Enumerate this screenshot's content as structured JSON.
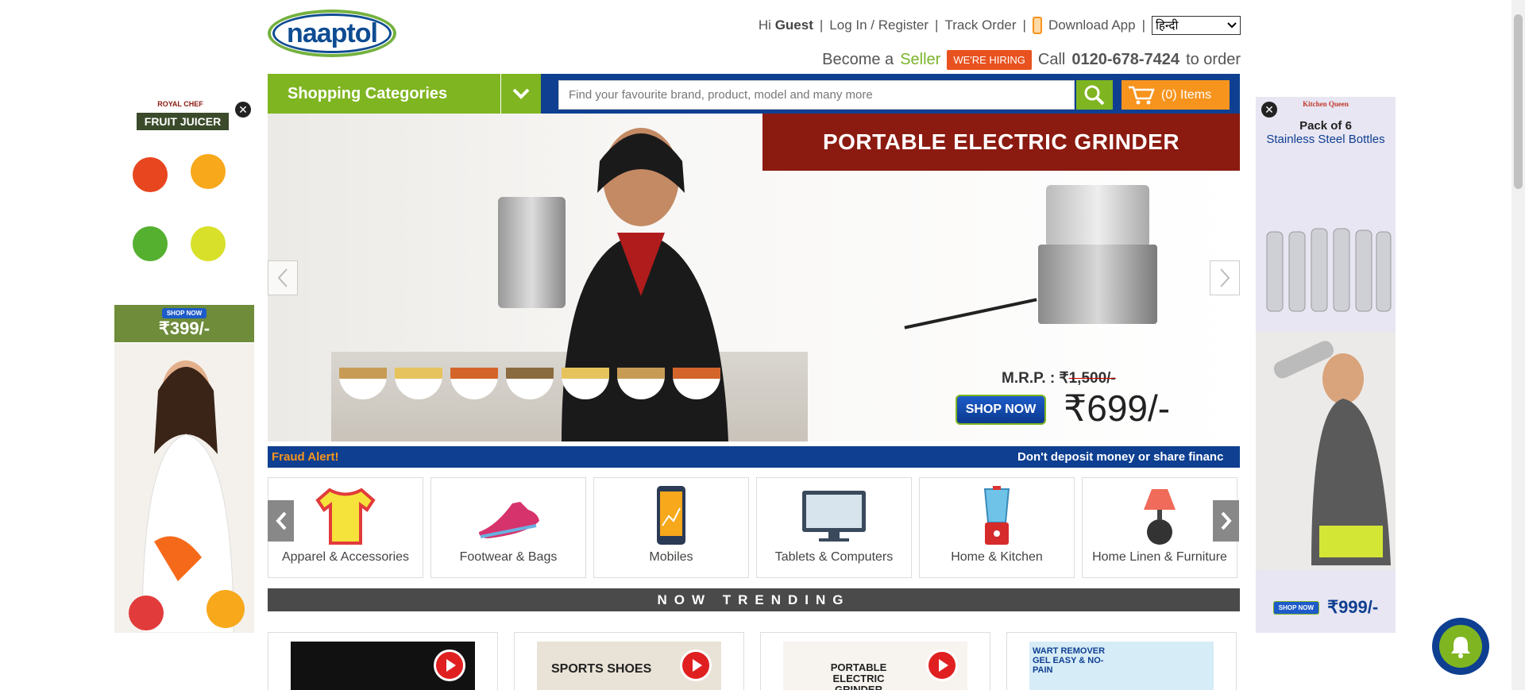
{
  "header": {
    "logo_text": "naaptol",
    "greeting_prefix": "Hi",
    "greeting_name": "Guest",
    "login_link": "Log In / Register",
    "track_order_link": "Track Order",
    "download_app_link": "Download App",
    "language_selected": "हिन्दी",
    "become_label": "Become a",
    "seller_link": "Seller",
    "hiring_badge": "WE'RE HIRING",
    "call_prefix": "Call",
    "phone_number": "0120-678-7424",
    "call_suffix": "to order"
  },
  "nav": {
    "categories_label": "Shopping Categories",
    "search_placeholder": "Find your favourite brand, product, model and many more",
    "cart_label": "(0) Items"
  },
  "banner": {
    "title": "PORTABLE ELECTRIC GRINDER",
    "mrp_label": "M.R.P. : ₹",
    "mrp_value": "1,500/-",
    "shop_now": "SHOP NOW",
    "price": "₹699/-"
  },
  "fraud": {
    "label": "Fraud Alert!",
    "text": "Don't deposit money or share financ"
  },
  "categories": [
    {
      "label": "Apparel & Accessories"
    },
    {
      "label": "Footwear & Bags"
    },
    {
      "label": "Mobiles"
    },
    {
      "label": "Tablets & Computers"
    },
    {
      "label": "Home & Kitchen"
    },
    {
      "label": "Home Linen & Furniture"
    }
  ],
  "trending": {
    "title": "NOW TRENDING",
    "cards": [
      {
        "caption": ""
      },
      {
        "caption": "SPORTS SHOES"
      },
      {
        "caption": "PORTABLE ELECTRIC GRINDER"
      },
      {
        "caption": "WART REMOVER GEL EASY & NO-PAIN"
      }
    ]
  },
  "ads": {
    "left": {
      "brand": "ROYAL CHEF",
      "title": "FRUIT JUICER",
      "shop_now": "SHOP NOW",
      "price": "₹399/-"
    },
    "right": {
      "brand": "Kitchen Queen",
      "title": "Pack of 6",
      "subtitle": "Stainless Steel Bottles",
      "shop_now": "SHOP NOW",
      "price": "₹999/-"
    }
  },
  "colors": {
    "brand_blue": "#0e3f91",
    "brand_green": "#7fb521",
    "accent_orange": "#f7941d",
    "banner_title_red": "#8b1a10"
  }
}
